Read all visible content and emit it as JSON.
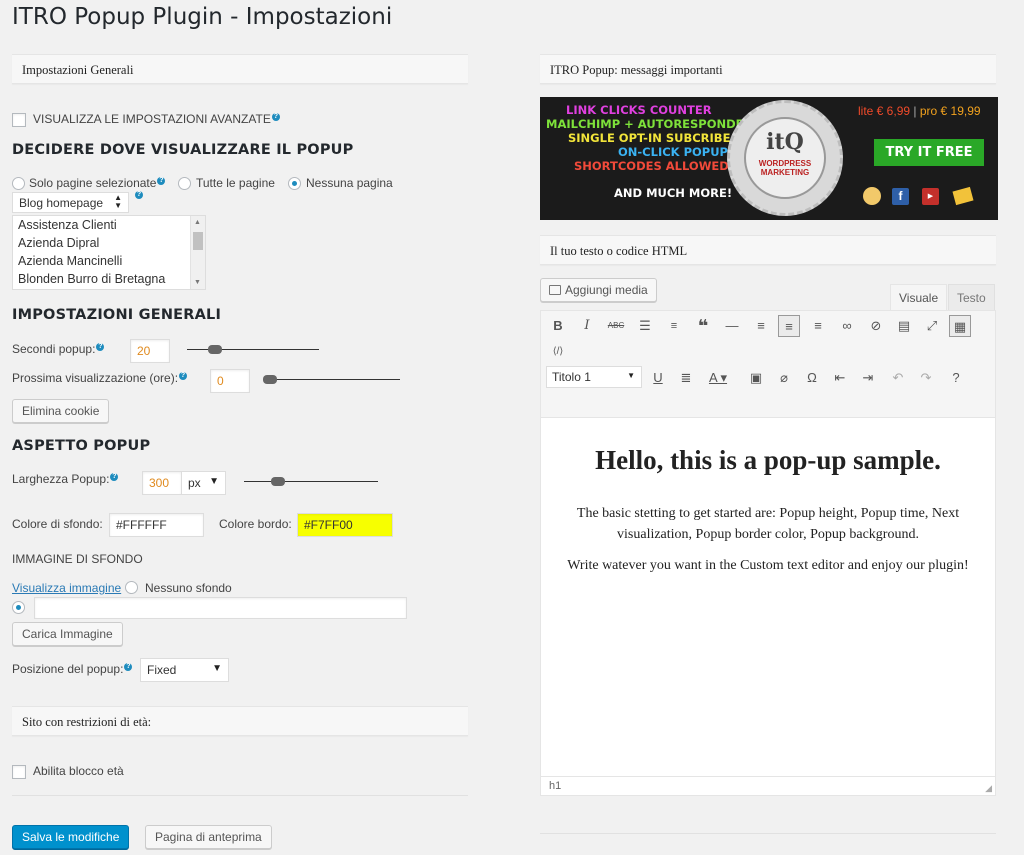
{
  "page": {
    "title": "ITRO Popup Plugin - Impostazioni"
  },
  "general_box": {
    "title": "Impostazioni Generali"
  },
  "advanced": {
    "label": "VISUALIZZA LE IMPOSTAZIONI AVANZATE"
  },
  "where": {
    "heading": "DECIDERE DOVE VISUALIZZARE IL POPUP",
    "radio_selected_pages": "Solo pagine selezionate",
    "radio_all_pages": "Tutte le pagine",
    "radio_no_page": "Nessuna pagina",
    "selected_radio": "Nessuna pagina",
    "spinner_value": "Blog homepage",
    "pages": [
      "Assistenza Clienti",
      "Azienda Dipral",
      "Azienda Mancinelli",
      "Blonden Burro di Bretagna"
    ]
  },
  "settings": {
    "heading": "IMPOSTAZIONI GENERALI",
    "seconds_label": "Secondi popup:",
    "seconds_value": "20",
    "seconds_slider": 0.21,
    "next_label": "Prossima visualizzazione (ore):",
    "next_value": "0",
    "next_slider": 0.03,
    "delete_cookie": "Elimina cookie"
  },
  "appearance": {
    "heading": "ASPETTO POPUP",
    "width_label": "Larghezza Popup:",
    "width_value": "300",
    "width_unit": "px",
    "width_slider": 0.25,
    "bg_color_label": "Colore di sfondo:",
    "bg_color_value": "#FFFFFF",
    "border_color_label": "Colore bordo:",
    "border_color_value": "#F7FF00",
    "bg_image_heading": "IMMAGINE DI SFONDO",
    "show_image_link": "Visualizza immagine",
    "no_bg": "Nessuno sfondo",
    "image_url": "",
    "upload_button": "Carica Immagine",
    "position_label": "Posizione del popup:",
    "position_value": "Fixed"
  },
  "age_box": {
    "title": "Sito con restrizioni di età:",
    "enable_label": "Abilita blocco età"
  },
  "actions": {
    "save": "Salva le modifiche",
    "preview": "Pagina di anteprima"
  },
  "messages_box": {
    "title": "ITRO Popup: messaggi importanti"
  },
  "banner": {
    "features": [
      "LINK CLICKS COUNTER",
      "MAILCHIMP + AUTORESPONDER",
      "SINGLE OPT-IN SUBCRIBE",
      "ON-CLICK POPUP",
      "SHORTCODES ALLOWED"
    ],
    "feature_colors": [
      "#e040e0",
      "#7ee23a",
      "#f2e43a",
      "#3ab2f2",
      "#f24a3a"
    ],
    "much_more": "AND MUCH MORE!",
    "logo_text": "itQ",
    "seal_line1": "WORDPRESS",
    "seal_line2": "MARKETING",
    "price_lite": "lite € 6,99",
    "price_sep": "|",
    "price_pro": "pro € 19,99",
    "try_button": "TRY IT FREE"
  },
  "editor": {
    "box_title": "Il tuo testo o codice HTML",
    "add_media": "Aggiungi media",
    "tab_visual": "Visuale",
    "tab_text": "Testo",
    "format_select": "Titolo 1",
    "heading": "Hello, this is a pop-up sample.",
    "para1": "The basic stetting to get started are: Popup height, Popup time, Next visualization, Popup border color, Popup background.",
    "para2": "Write watever you want in the Custom text editor and enjoy our plugin!",
    "path": "h1"
  }
}
